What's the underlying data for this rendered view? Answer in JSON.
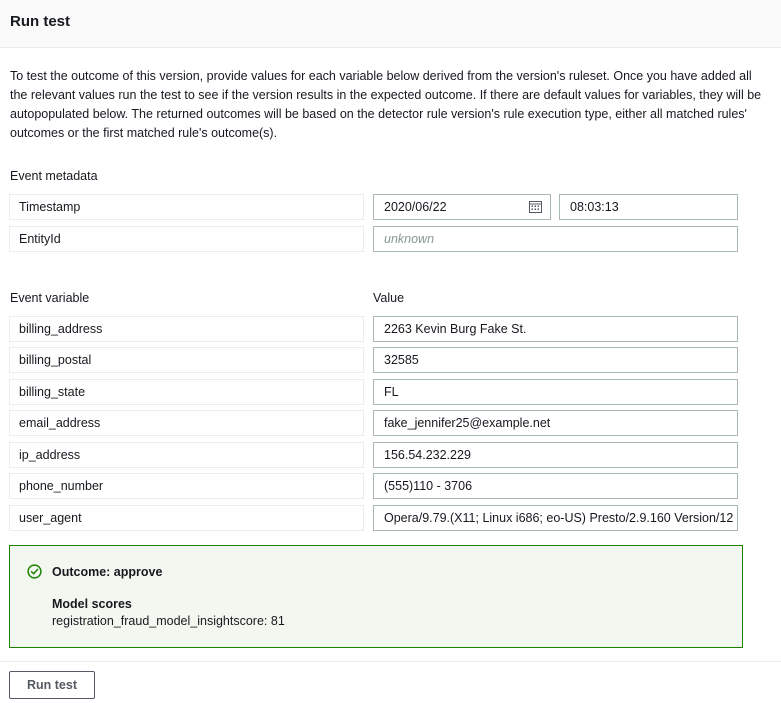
{
  "header": {
    "title": "Run test"
  },
  "description": "To test the outcome of this version, provide values for each variable below derived from the version's ruleset. Once you have added all the relevant values run the test to see if the version results in the expected outcome. If there are default values for variables, they will be autopopulated below. The returned outcomes will be based on the detector rule version's rule execution type, either all matched rules' outcomes or the first matched rule's outcome(s).",
  "metadata": {
    "section_label": "Event metadata",
    "timestamp_label": "Timestamp",
    "date_value": "2020/06/22",
    "time_value": "08:03:13",
    "entity_label": "EntityId",
    "entity_placeholder": "unknown"
  },
  "variables": {
    "col_variable": "Event variable",
    "col_value": "Value",
    "rows": [
      {
        "name": "billing_address",
        "value": "2263 Kevin Burg Fake St."
      },
      {
        "name": "billing_postal",
        "value": "32585"
      },
      {
        "name": "billing_state",
        "value": "FL"
      },
      {
        "name": "email_address",
        "value": "fake_jennifer25@example.net"
      },
      {
        "name": "ip_address",
        "value": "156.54.232.229"
      },
      {
        "name": "phone_number",
        "value": "(555)110 - 3706"
      },
      {
        "name": "user_agent",
        "value": "Opera/9.79.(X11; Linux i686; eo-US) Presto/2.9.160 Version/12"
      }
    ]
  },
  "outcome": {
    "title": "Outcome: approve",
    "model_scores_label": "Model scores",
    "model_score_line": "registration_fraud_model_insightscore: 81",
    "icon": "check-circle-icon",
    "color": "#1d8102"
  },
  "footer": {
    "run_label": "Run test"
  }
}
